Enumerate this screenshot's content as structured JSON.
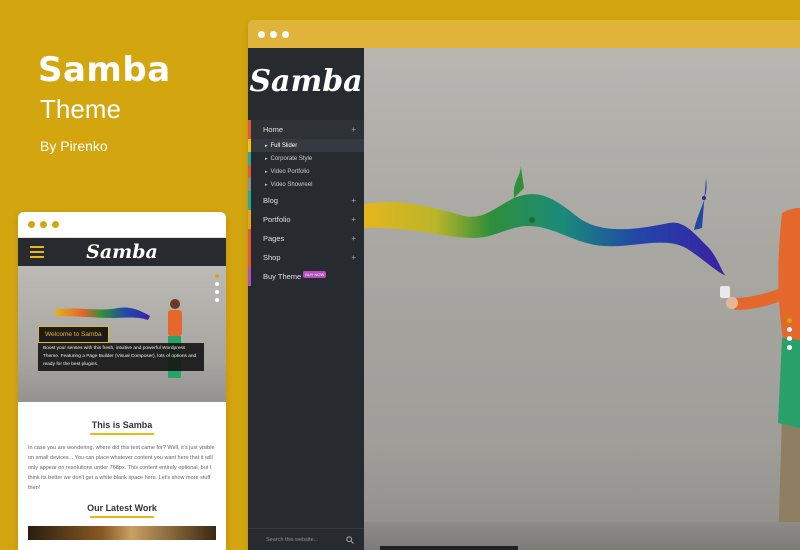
{
  "hero": {
    "title": "Samba",
    "subtitle": "Theme",
    "author": "By Pirenko"
  },
  "desktop": {
    "logo": "Samba",
    "menu": [
      {
        "label": "Home",
        "expand": "+"
      },
      {
        "label": "Blog",
        "expand": "+"
      },
      {
        "label": "Portfolio",
        "expand": "+"
      },
      {
        "label": "Pages",
        "expand": "+"
      },
      {
        "label": "Shop",
        "expand": "+"
      },
      {
        "label": "Buy Theme",
        "badge": "BUY NOW"
      }
    ],
    "submenu": [
      "Full Slider",
      "Corporate Style",
      "Video Portfolio",
      "Video Showreel"
    ],
    "search_placeholder": "Search this website...",
    "search_icon": "magnifier-icon",
    "slider_dots": 4
  },
  "mobile": {
    "logo": "Samba",
    "welcome": "Welcome to Samba",
    "caption": "Boost your senses with this fresh, intuitive and powerful Wordpress Theme. Featuring a Page Builder (Visual Composer), lots of options and ready for the best plugins.",
    "heading1": "This is Samba",
    "paragraph": "In case you are wondering, where did this text came for? Well, it's just visible on small devices... You can place whatever content you want here that it will only appear on resolutions under 768px. This content entirely optional, but I think its better we don't get a white blank space here. Let's show more stuff then!",
    "heading2": "Our Latest Work"
  },
  "colors": {
    "background": "#d3a60f",
    "accent": "#e8b71a",
    "sidebar": "#272b2f"
  }
}
